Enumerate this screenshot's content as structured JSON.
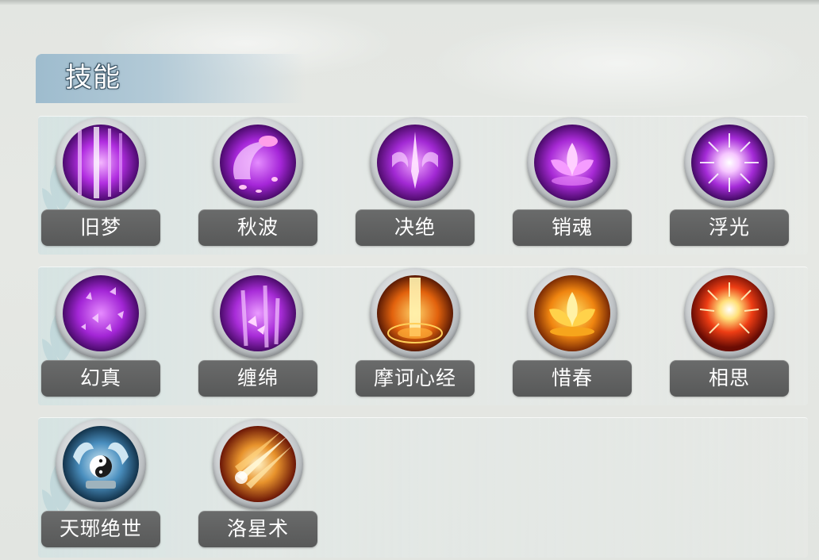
{
  "header": {
    "title": "技能"
  },
  "skills": [
    {
      "label": "旧梦",
      "icon": "purple-rays-icon",
      "theme": "purple"
    },
    {
      "label": "秋波",
      "icon": "purple-petal-swirl-icon",
      "theme": "purple"
    },
    {
      "label": "决绝",
      "icon": "purple-blade-ornament-icon",
      "theme": "purple"
    },
    {
      "label": "销魂",
      "icon": "purple-lotus-icon",
      "theme": "purple"
    },
    {
      "label": "浮光",
      "icon": "purple-burst-icon",
      "theme": "purple"
    },
    {
      "label": "幻真",
      "icon": "purple-butterflies-icon",
      "theme": "purple"
    },
    {
      "label": "缠绵",
      "icon": "purple-butterfly-bamboo-icon",
      "theme": "purple"
    },
    {
      "label": "摩诃心经",
      "icon": "orange-light-pillar-icon",
      "theme": "orange"
    },
    {
      "label": "惜春",
      "icon": "orange-lotus-icon",
      "theme": "orange"
    },
    {
      "label": "相思",
      "icon": "red-burst-icon",
      "theme": "red"
    },
    {
      "label": "天琊绝世",
      "icon": "yin-yang-totem-icon",
      "theme": "blue"
    },
    {
      "label": "洛星术",
      "icon": "meteor-strike-icon",
      "theme": "gold"
    }
  ],
  "colors": {
    "purple": "#a21fd6",
    "orange": "#f08a10",
    "red": "#e0301c",
    "blue": "#3a7fb0",
    "gold": "#f2b33a",
    "label_bg": "#5f6060",
    "title_bar": "#a9c3d2"
  }
}
